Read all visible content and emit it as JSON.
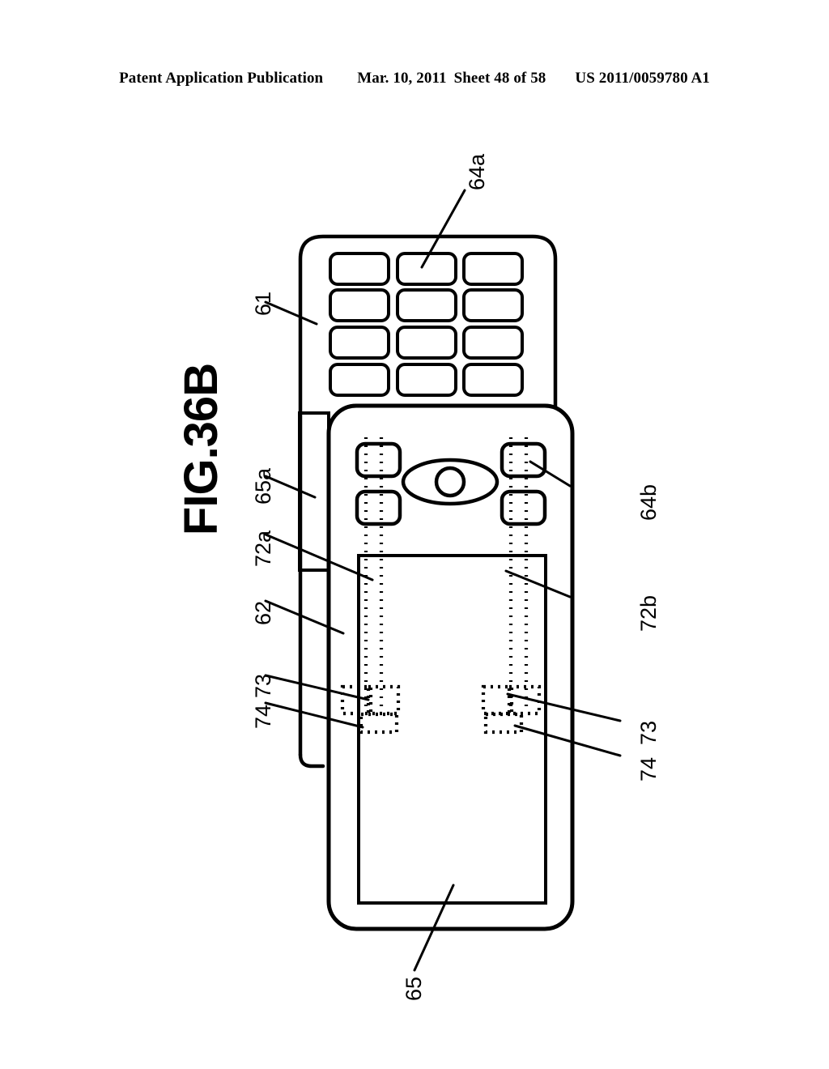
{
  "header": {
    "publication": "Patent Application Publication",
    "date": "Mar. 10, 2011",
    "sheet": "Sheet 48 of 58",
    "number": "US 2011/0059780 A1"
  },
  "figure": {
    "label": "FIG.36B",
    "orientation": "rotated-90-ccw"
  },
  "refs": {
    "r64a": "64a",
    "r61": "61",
    "r65a": "65a",
    "r72a": "72a",
    "r62": "62",
    "r73_left": "73",
    "r74_left": "74",
    "r64b": "64b",
    "r72b": "72b",
    "r73_right": "73",
    "r74_right": "74",
    "r65": "65"
  },
  "drawing": {
    "description": "Exploded/overlaid view of a slide-type portable terminal shown sideways: an upper keypad housing with a 3x4 array of rounded-rectangle keys, and a lower display housing bearing an oval speaker/lens element, two pairs of rounded keys, a large display window, and hidden (dotted) internal members.",
    "keypad_rows": 4,
    "keypad_cols": 3,
    "side_button_pairs": 2,
    "side_buttons_per_pair": 2,
    "hidden_line_style": "dotted",
    "stroke_color": "#000000"
  },
  "colors": {
    "ink": "#000000",
    "paper": "#ffffff"
  }
}
